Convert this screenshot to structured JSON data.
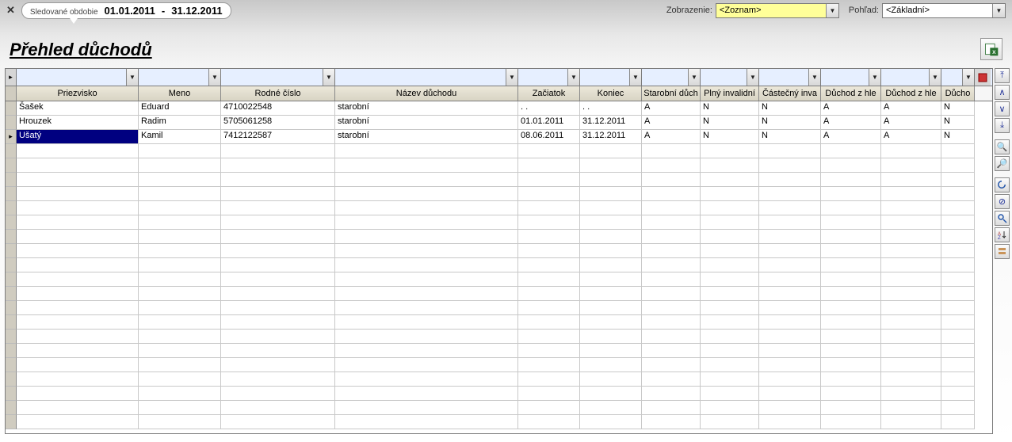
{
  "topbar": {
    "period_label": "Sledované obdobie",
    "period_from": "01.01.2011",
    "period_sep": "-",
    "period_to": "31.12.2011",
    "zobrazenie_label": "Zobrazenie:",
    "zobrazenie_value": "<Zoznam>",
    "pohlad_label": "Pohľad:",
    "pohlad_value": "<Základní>"
  },
  "page_title": "Přehled důchodů",
  "columns": {
    "priezvisko": "Priezvisko",
    "meno": "Meno",
    "rodne": "Rodné číslo",
    "nazev": "Název důchodu",
    "zaciatok": "Začiatok",
    "koniec": "Koniec",
    "starobni": "Starobní důch",
    "plny": "Plný invalidní",
    "castecny": "Částečný inva",
    "duch1": "Důchod z hle",
    "duch2": "Důchod z hle",
    "duch3": "Důcho"
  },
  "rows": [
    {
      "priezvisko": "Šašek",
      "meno": "Eduard",
      "rodne": "4710022548",
      "nazev": "starobní",
      "zac": ". .",
      "kon": ". .",
      "a": "A",
      "b": "N",
      "c": "N",
      "d": "A",
      "e": "A",
      "f": "N",
      "sel": false
    },
    {
      "priezvisko": "Hrouzek",
      "meno": "Radim",
      "rodne": "5705061258",
      "nazev": "starobní",
      "zac": "01.01.2011",
      "kon": "31.12.2011",
      "a": "A",
      "b": "N",
      "c": "N",
      "d": "A",
      "e": "A",
      "f": "N",
      "sel": false
    },
    {
      "priezvisko": "Ušatý",
      "meno": "Kamil",
      "rodne": "7412122587",
      "nazev": "starobní",
      "zac": "08.06.2011",
      "kon": "31.12.2011",
      "a": "A",
      "b": "N",
      "c": "N",
      "d": "A",
      "e": "A",
      "f": "N",
      "sel": true
    }
  ]
}
